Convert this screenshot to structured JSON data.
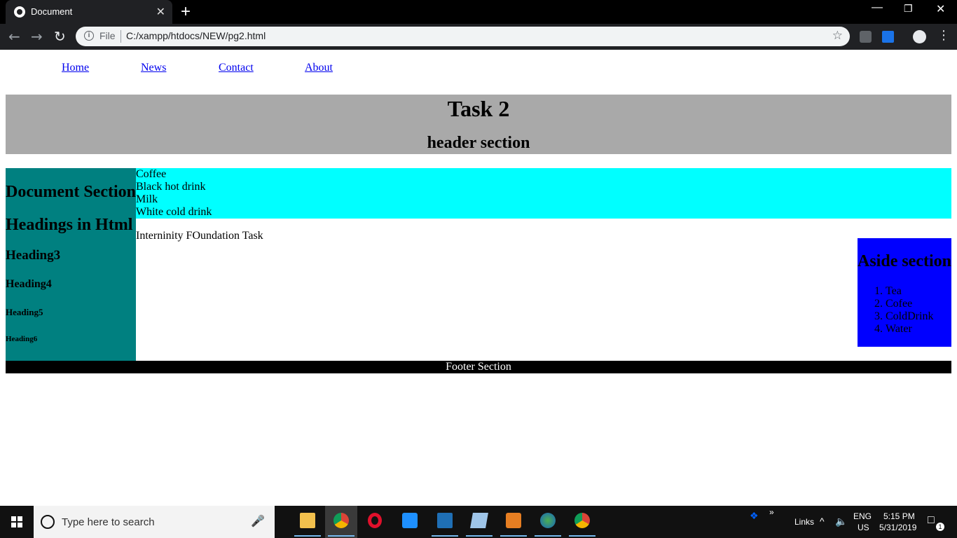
{
  "browser": {
    "tab_title": "Document",
    "close_glyph": "✕",
    "newtab_glyph": "+",
    "file_label": "File",
    "url": "C:/xampp/htdocs/NEW/pg2.html"
  },
  "nav": {
    "home": "Home",
    "news": "News",
    "contact": "Contact",
    "about": "About"
  },
  "header": {
    "title": "Task 2",
    "subtitle": "header section"
  },
  "left_section": {
    "h1": "Document Section",
    "h2": "Headings in Html",
    "h3": "Heading3",
    "h4": "Heading4",
    "h5": "Heading5",
    "h6": "Heading6"
  },
  "drinks": {
    "line1": "Coffee",
    "line2": "Black hot drink",
    "line3": "Milk",
    "line4": "White cold drink"
  },
  "main_text": "Interninity FOundation Task",
  "aside": {
    "title": "Aside section",
    "items": [
      "Tea",
      "Cofee",
      "ColdDrink",
      "Water"
    ]
  },
  "footer": "Footer Section",
  "taskbar": {
    "search_placeholder": "Type here to search",
    "links_label": "Links",
    "lang_top": "ENG",
    "lang_bottom": "US",
    "time": "5:15 PM",
    "date": "5/31/2019",
    "notification_count": "1"
  },
  "colors": {
    "header_bg": "#a9a9a9",
    "left_bg": "#008080",
    "drinks_bg": "#00ffff",
    "aside_bg": "#0000ff",
    "footer_bg": "#000000"
  }
}
